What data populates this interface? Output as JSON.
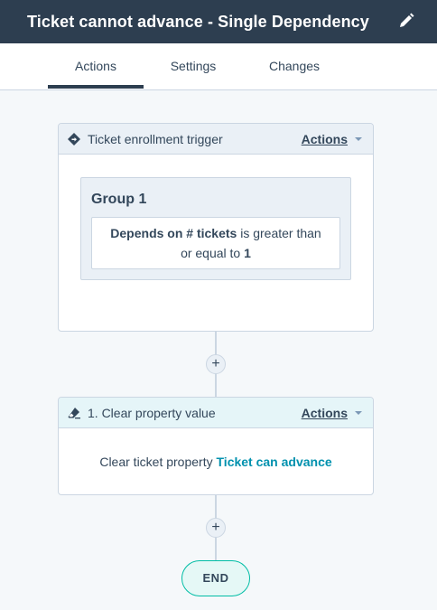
{
  "header": {
    "title": "Ticket cannot advance - Single Dependency"
  },
  "tabs": [
    {
      "label": "Actions",
      "active": true
    },
    {
      "label": "Settings",
      "active": false
    },
    {
      "label": "Changes",
      "active": false
    }
  ],
  "trigger": {
    "label": "Ticket enrollment trigger",
    "actions_label": "Actions",
    "group": {
      "title": "Group 1",
      "filter": {
        "property": "Depends on # tickets",
        "operator_line1": "is greater than",
        "operator_line2": "or equal to",
        "value": "1"
      }
    }
  },
  "step": {
    "label": "1. Clear property value",
    "actions_label": "Actions",
    "body_prefix": "Clear ticket property",
    "body_property": "Ticket can advance"
  },
  "plus_label": "+",
  "end_label": "END",
  "colors": {
    "header_bg": "#2d3e50",
    "accent": "#0091ae",
    "end_border": "#00bda5"
  }
}
